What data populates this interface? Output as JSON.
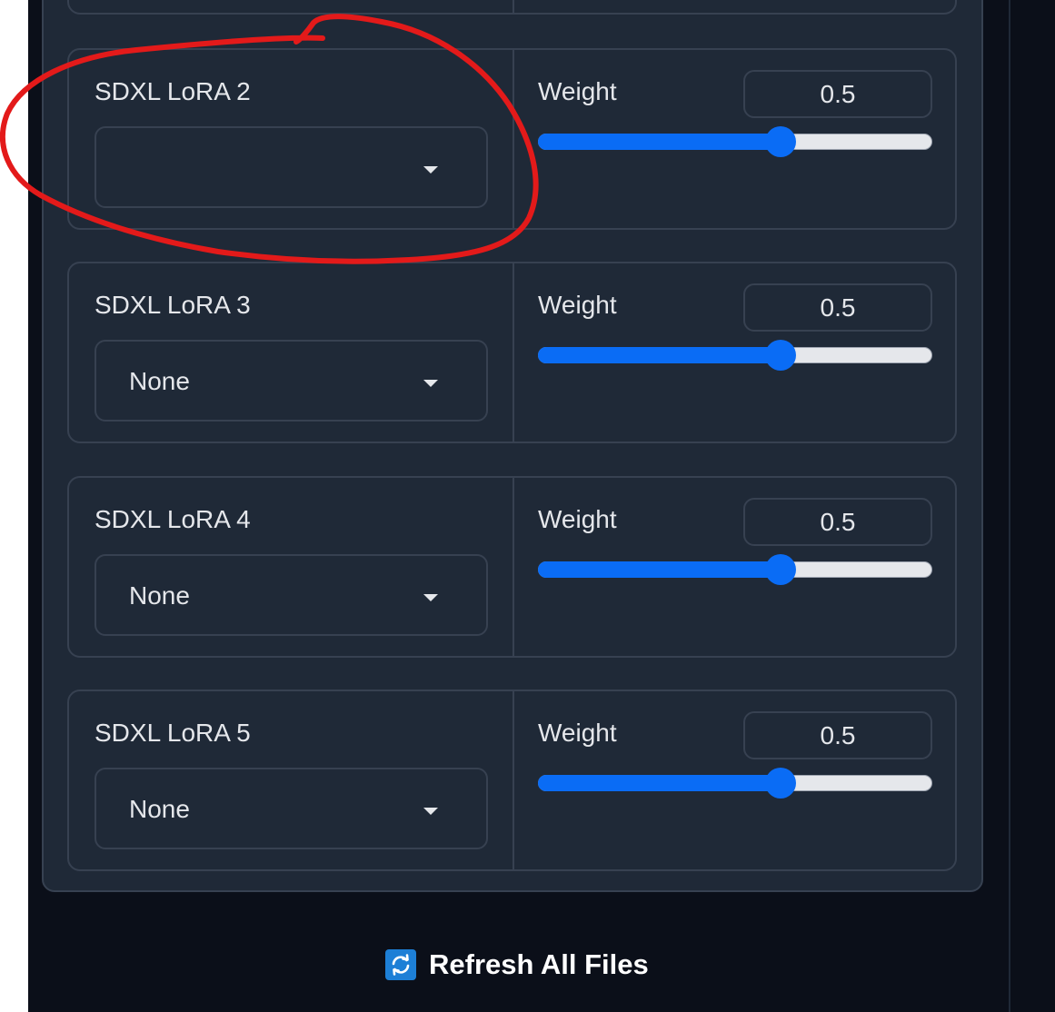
{
  "colors": {
    "background": "#0b0f19",
    "panel": "#1f2937",
    "border": "#374151",
    "text": "#e5e7eb",
    "accent": "#0a6cf5",
    "annotation": "#e31a1a"
  },
  "loras": [
    {
      "label": "SDXL LoRA 2",
      "selected": "",
      "weight_label": "Weight",
      "weight_value": "0.5",
      "slider_fraction": 0.615
    },
    {
      "label": "SDXL LoRA 3",
      "selected": "None",
      "weight_label": "Weight",
      "weight_value": "0.5",
      "slider_fraction": 0.615
    },
    {
      "label": "SDXL LoRA 4",
      "selected": "None",
      "weight_label": "Weight",
      "weight_value": "0.5",
      "slider_fraction": 0.615
    },
    {
      "label": "SDXL LoRA 5",
      "selected": "None",
      "weight_label": "Weight",
      "weight_value": "0.5",
      "slider_fraction": 0.615
    }
  ],
  "refresh_button": {
    "label": "Refresh All Files",
    "icon": "refresh-icon"
  }
}
